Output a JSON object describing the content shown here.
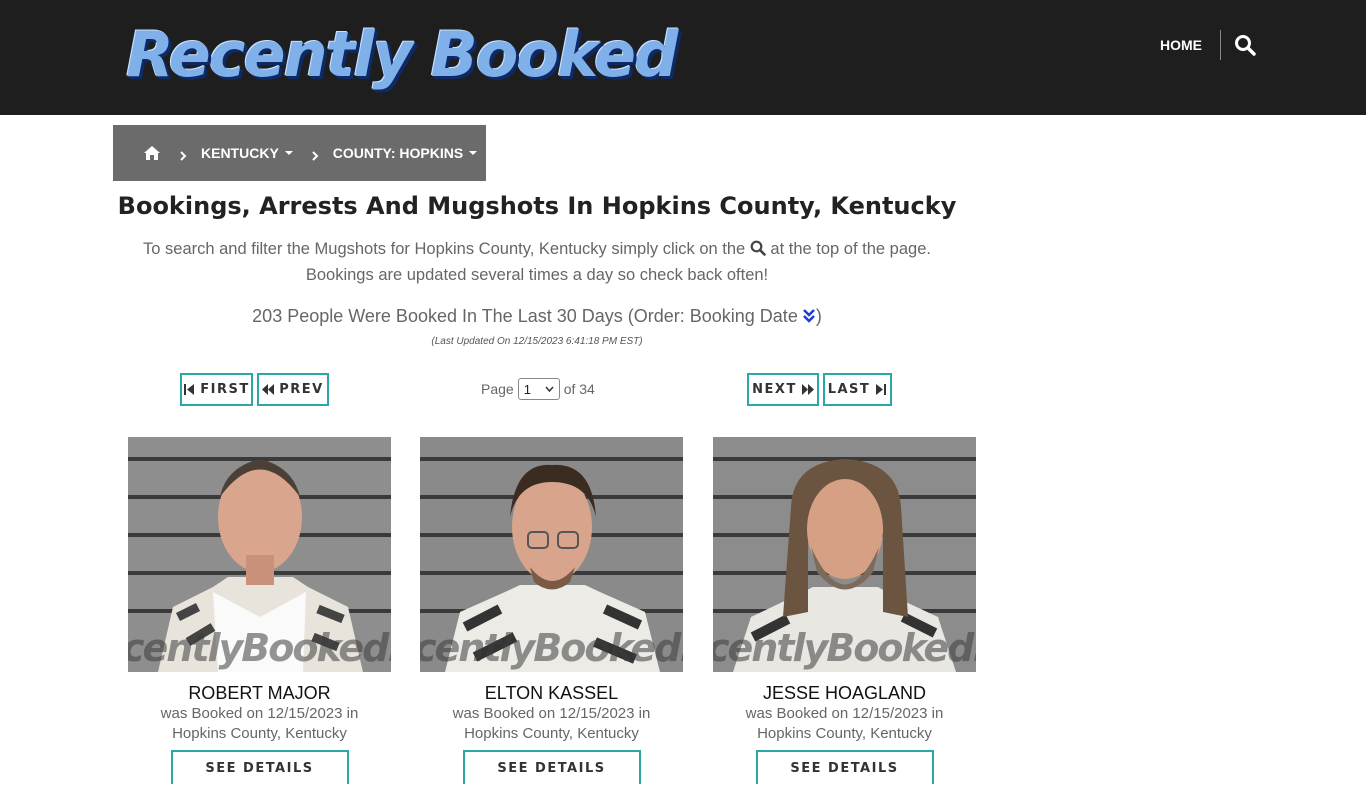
{
  "header": {
    "logo_text": "Recently Booked",
    "nav_home": "HOME",
    "search_icon": "search-icon"
  },
  "breadcrumb": {
    "home_icon": "home-icon",
    "state": "KENTUCKY",
    "county": "COUNTY: HOPKINS"
  },
  "main": {
    "title": "Bookings, Arrests And Mugshots In Hopkins County, Kentucky",
    "intro_part1": "To search and filter the Mugshots for Hopkins County, Kentucky simply click on the",
    "intro_part2": "at the top of the page.",
    "intro_line2": "Bookings are updated several times a day so check back often!",
    "count_text": "203 People Were Booked In The Last 30 Days (Order: Booking Date",
    "count_close": ")",
    "last_updated": "(Last Updated On 12/15/2023 6:41:18 PM EST)"
  },
  "pager": {
    "first": "FIRST",
    "prev": "PREV",
    "next": "NEXT",
    "last": "LAST",
    "page_label": "Page",
    "current_page": "1",
    "of_label": "of 34"
  },
  "watermark": "centlyBooked.co",
  "bookings": [
    {
      "name": "ROBERT MAJOR",
      "line1": "was Booked on 12/15/2023 in",
      "line2": "Hopkins County, Kentucky",
      "button": "SEE DETAILS"
    },
    {
      "name": "ELTON KASSEL",
      "line1": "was Booked on 12/15/2023 in",
      "line2": "Hopkins County, Kentucky",
      "button": "SEE DETAILS"
    },
    {
      "name": "JESSE HOAGLAND",
      "line1": "was Booked on 12/15/2023 in",
      "line2": "Hopkins County, Kentucky",
      "button": "SEE DETAILS"
    }
  ],
  "colors": {
    "header_bg": "#1e1e1e",
    "breadcrumb_bg": "#6b6b6b",
    "accent_teal": "#2aa7a7",
    "logo_blue": "#7fb0ea"
  }
}
